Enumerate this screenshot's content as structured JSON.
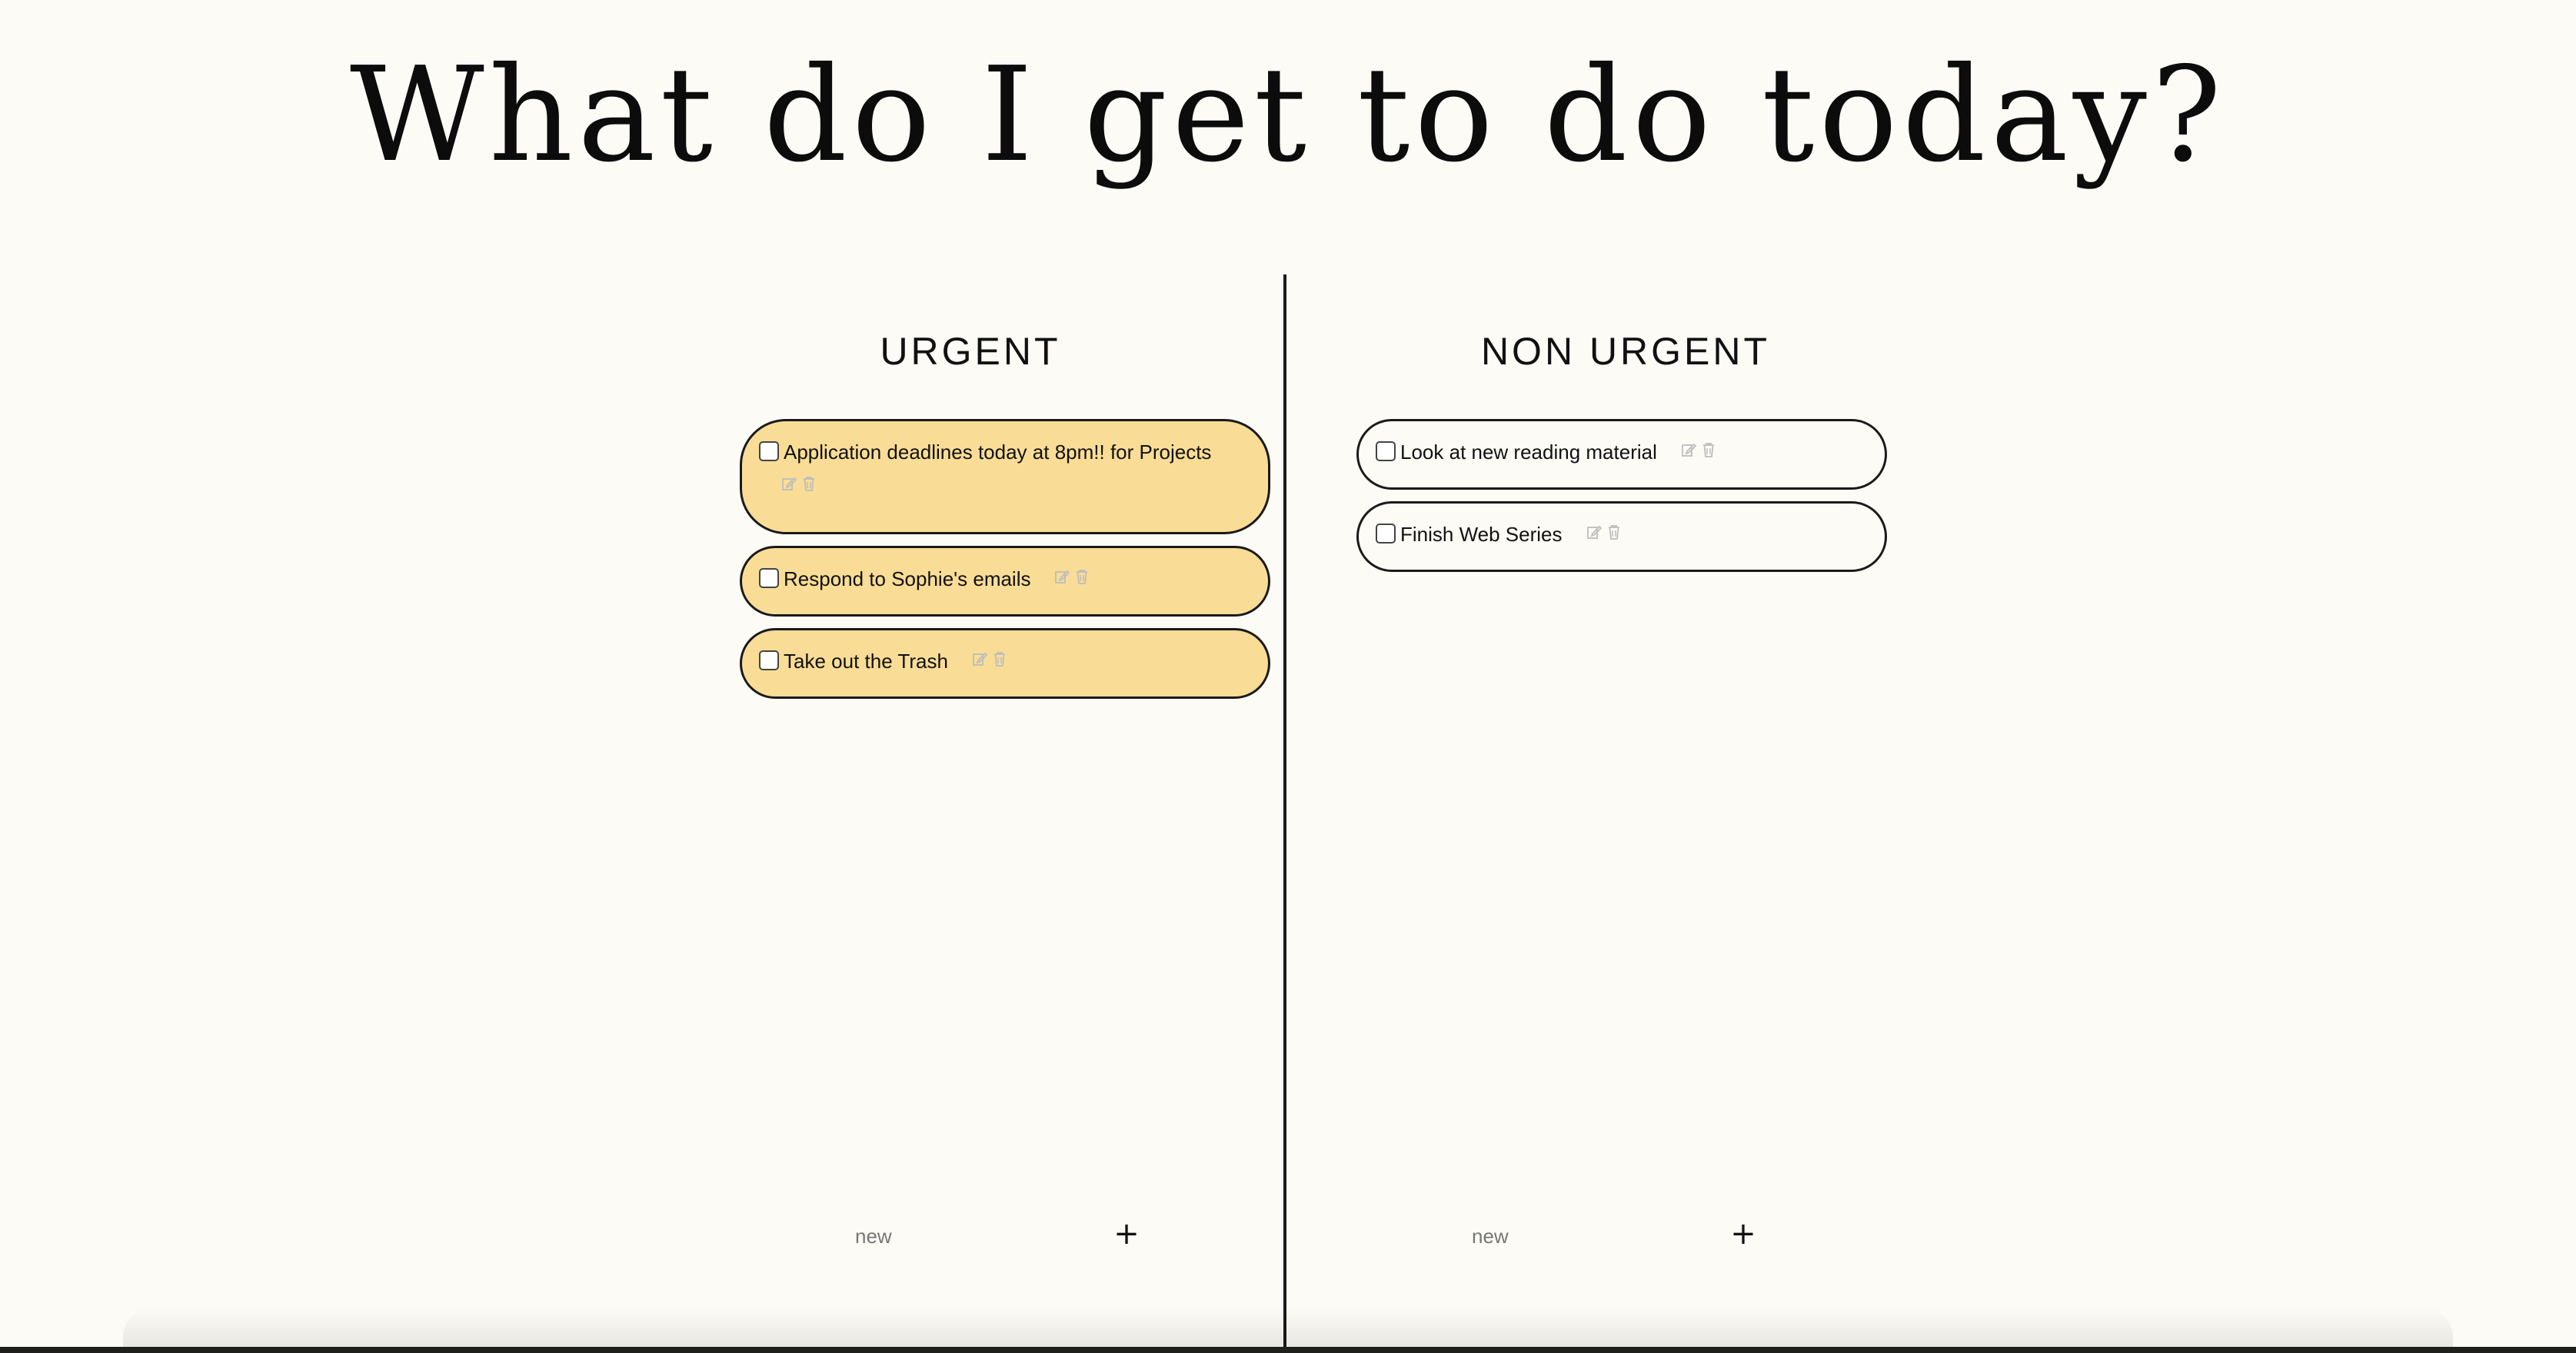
{
  "page": {
    "title": "What do I get to do today?"
  },
  "columns": {
    "urgent": {
      "title": "URGENT",
      "tasks": [
        {
          "label": "Application deadlines today at 8pm!! for Projects",
          "checked": false
        },
        {
          "label": "Respond to Sophie's emails",
          "checked": false
        },
        {
          "label": "Take out the Trash",
          "checked": false
        }
      ],
      "new_placeholder": "new",
      "add_label": "+"
    },
    "non_urgent": {
      "title": "NON URGENT",
      "tasks": [
        {
          "label": "Look at new reading material",
          "checked": false
        },
        {
          "label": "Finish Web Series",
          "checked": false
        }
      ],
      "new_placeholder": "new",
      "add_label": "+"
    }
  },
  "colors": {
    "background": "#fcfbf6",
    "urgent_task": "#f9dd96",
    "border": "#1a1a1a",
    "icon": "#bdbdbd"
  },
  "icons": {
    "edit": "edit-icon",
    "delete": "trash-icon"
  }
}
